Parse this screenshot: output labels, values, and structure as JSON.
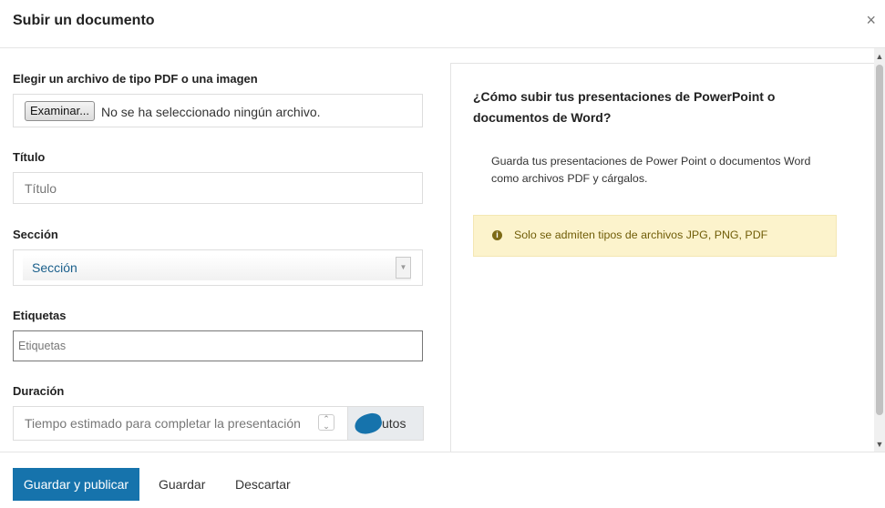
{
  "modal": {
    "title": "Subir un documento",
    "close_icon": "close-icon",
    "close_text": "×"
  },
  "form": {
    "file": {
      "label": "Elegir un archivo de tipo PDF o una imagen",
      "button": "Examinar...",
      "status": "No se ha seleccionado ningún archivo."
    },
    "title": {
      "label": "Título",
      "placeholder": "Título"
    },
    "section": {
      "label": "Sección",
      "selected": "Sección"
    },
    "tags": {
      "label": "Etiquetas",
      "placeholder": "Etiquetas"
    },
    "duration": {
      "label": "Duración",
      "placeholder": "Tiempo estimado para completar la presentación",
      "addon": "utos"
    }
  },
  "help": {
    "title": "¿Cómo subir tus presentaciones de PowerPoint o documentos de Word?",
    "text": "Guarda tus presentaciones de Power Point o documentos Word como archivos PDF y cárgalos.",
    "alert_icon": "info-icon",
    "alert": "Solo se admiten tipos de archivos JPG, PNG, PDF"
  },
  "footer": {
    "primary": "Guardar y publicar",
    "save": "Guardar",
    "discard": "Descartar"
  },
  "colors": {
    "primary": "#1673ac",
    "alert_background": "#fcf3cc",
    "alert_text": "#705d08"
  }
}
